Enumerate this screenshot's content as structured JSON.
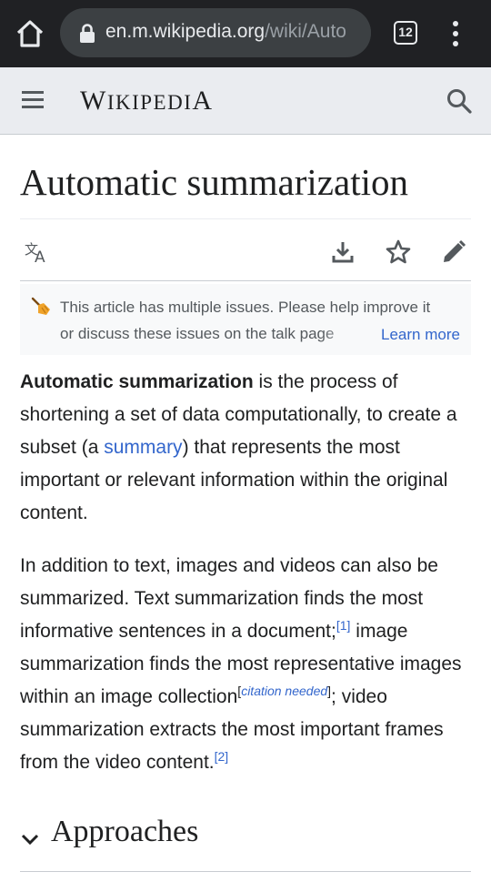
{
  "browser": {
    "url_host": "en.m.wikipedia.org",
    "url_path": "/wiki/Auto",
    "tab_count": "12",
    "icons": [
      "home-icon",
      "lock-icon",
      "tab-switcher-icon",
      "overflow-menu-icon"
    ]
  },
  "header": {
    "wordmark_w": "W",
    "wordmark_iki": "IKIPEDI",
    "wordmark_a": "A",
    "icons": [
      "hamburger-menu-icon",
      "search-icon"
    ]
  },
  "article": {
    "title": "Automatic summarization",
    "actions": [
      "language-icon",
      "download-icon",
      "watch-star-icon",
      "edit-pencil-icon"
    ],
    "issues": {
      "text": "This article has multiple issues. Please help improve it or discuss these issues on the talk page",
      "learn_more": "Learn more",
      "icon": "broom-icon"
    },
    "p1": {
      "bold": "Automatic summarization",
      "t1": " is the process of shortening a set of data computationally, to create a subset (a ",
      "link": "summary",
      "t2": ") that represents the most important or relevant information within the original content."
    },
    "p2": {
      "t1": "In addition to text, images and videos can also be summarized. Text summarization finds the most informative sentences in a document;",
      "ref1": "[1]",
      "t2": " image summarization finds the most representative images within an image collection",
      "cn_open": "[",
      "cn": "citation needed",
      "cn_close": "]",
      "t3": "; video summarization extracts the most important frames from the video content.",
      "ref2": "[2]"
    },
    "section": {
      "title": "Approaches",
      "icon": "chevron-down-icon"
    }
  },
  "colors": {
    "browser_bar": "#202124",
    "header_bg": "#eaecf0",
    "link": "#3366cc",
    "text": "#202122"
  }
}
